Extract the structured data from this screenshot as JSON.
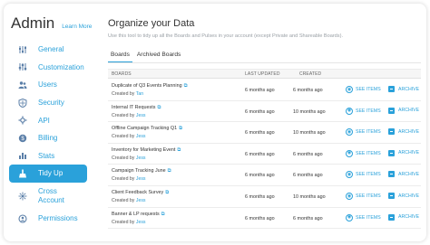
{
  "sidebar": {
    "title": "Admin",
    "learn_more": "Learn More",
    "items": [
      {
        "label": "General",
        "icon": "sliders-icon"
      },
      {
        "label": "Customization",
        "icon": "settings-icon"
      },
      {
        "label": "Users",
        "icon": "users-icon"
      },
      {
        "label": "Security",
        "icon": "shield-icon"
      },
      {
        "label": "API",
        "icon": "api-icon"
      },
      {
        "label": "Billing",
        "icon": "billing-icon"
      },
      {
        "label": "Stats",
        "icon": "stats-icon"
      },
      {
        "label": "Tidy Up",
        "icon": "broom-icon"
      },
      {
        "label": "Cross Account",
        "icon": "cross-account-icon"
      },
      {
        "label": "Permissions",
        "icon": "permissions-icon"
      }
    ],
    "active": "Tidy Up"
  },
  "main": {
    "title": "Organize your Data",
    "description": "Use this tool to tidy up all the Boards and Pulses in your account (except Private and Shareable Boards).",
    "tabs": [
      {
        "label": "Boards",
        "active": true
      },
      {
        "label": "Archived Boards",
        "active": false
      }
    ],
    "columns": {
      "boards": "BOARDS",
      "last_updated": "LAST UPDATED",
      "created": "CREATED"
    },
    "rows": [
      {
        "name": "Duplicate of Q3 Events Planning",
        "created_by_prefix": "Created by",
        "creator": "Tan",
        "last_updated": "6 months ago",
        "created": "6 months ago",
        "see_items": "SEE ITEMS",
        "archive": "ARCHIVE"
      },
      {
        "name": "Internal IT Requests",
        "created_by_prefix": "Created by",
        "creator": "Jess",
        "last_updated": "6 months ago",
        "created": "10 months ago",
        "see_items": "SEE ITEMS",
        "archive": "ARCHIVE"
      },
      {
        "name": "Offline Campaign Tracking Q1",
        "created_by_prefix": "Created by",
        "creator": "Jess",
        "last_updated": "6 months ago",
        "created": "10 months ago",
        "see_items": "SEE ITEMS",
        "archive": "ARCHIVE"
      },
      {
        "name": "Inventory for Marketing Event",
        "created_by_prefix": "Created by",
        "creator": "Jess",
        "last_updated": "6 months ago",
        "created": "6 months ago",
        "see_items": "SEE ITEMS",
        "archive": "ARCHIVE"
      },
      {
        "name": "Campaign Tracking June",
        "created_by_prefix": "Created by",
        "creator": "Jess",
        "last_updated": "6 months ago",
        "created": "6 months ago",
        "see_items": "SEE ITEMS",
        "archive": "ARCHIVE"
      },
      {
        "name": "Client Feedback Survey",
        "created_by_prefix": "Created by",
        "creator": "Jess",
        "last_updated": "6 months ago",
        "created": "10 months ago",
        "see_items": "SEE ITEMS",
        "archive": "ARCHIVE"
      },
      {
        "name": "Banner & LP requests",
        "created_by_prefix": "Created by",
        "creator": "Jess",
        "last_updated": "6 months ago",
        "created": "6 months ago",
        "see_items": "SEE ITEMS",
        "archive": "ARCHIVE"
      }
    ]
  },
  "colors": {
    "accent": "#2aa1da",
    "icon": "#5b7fa8",
    "text": "#333333",
    "muted": "#9aa0a6"
  }
}
